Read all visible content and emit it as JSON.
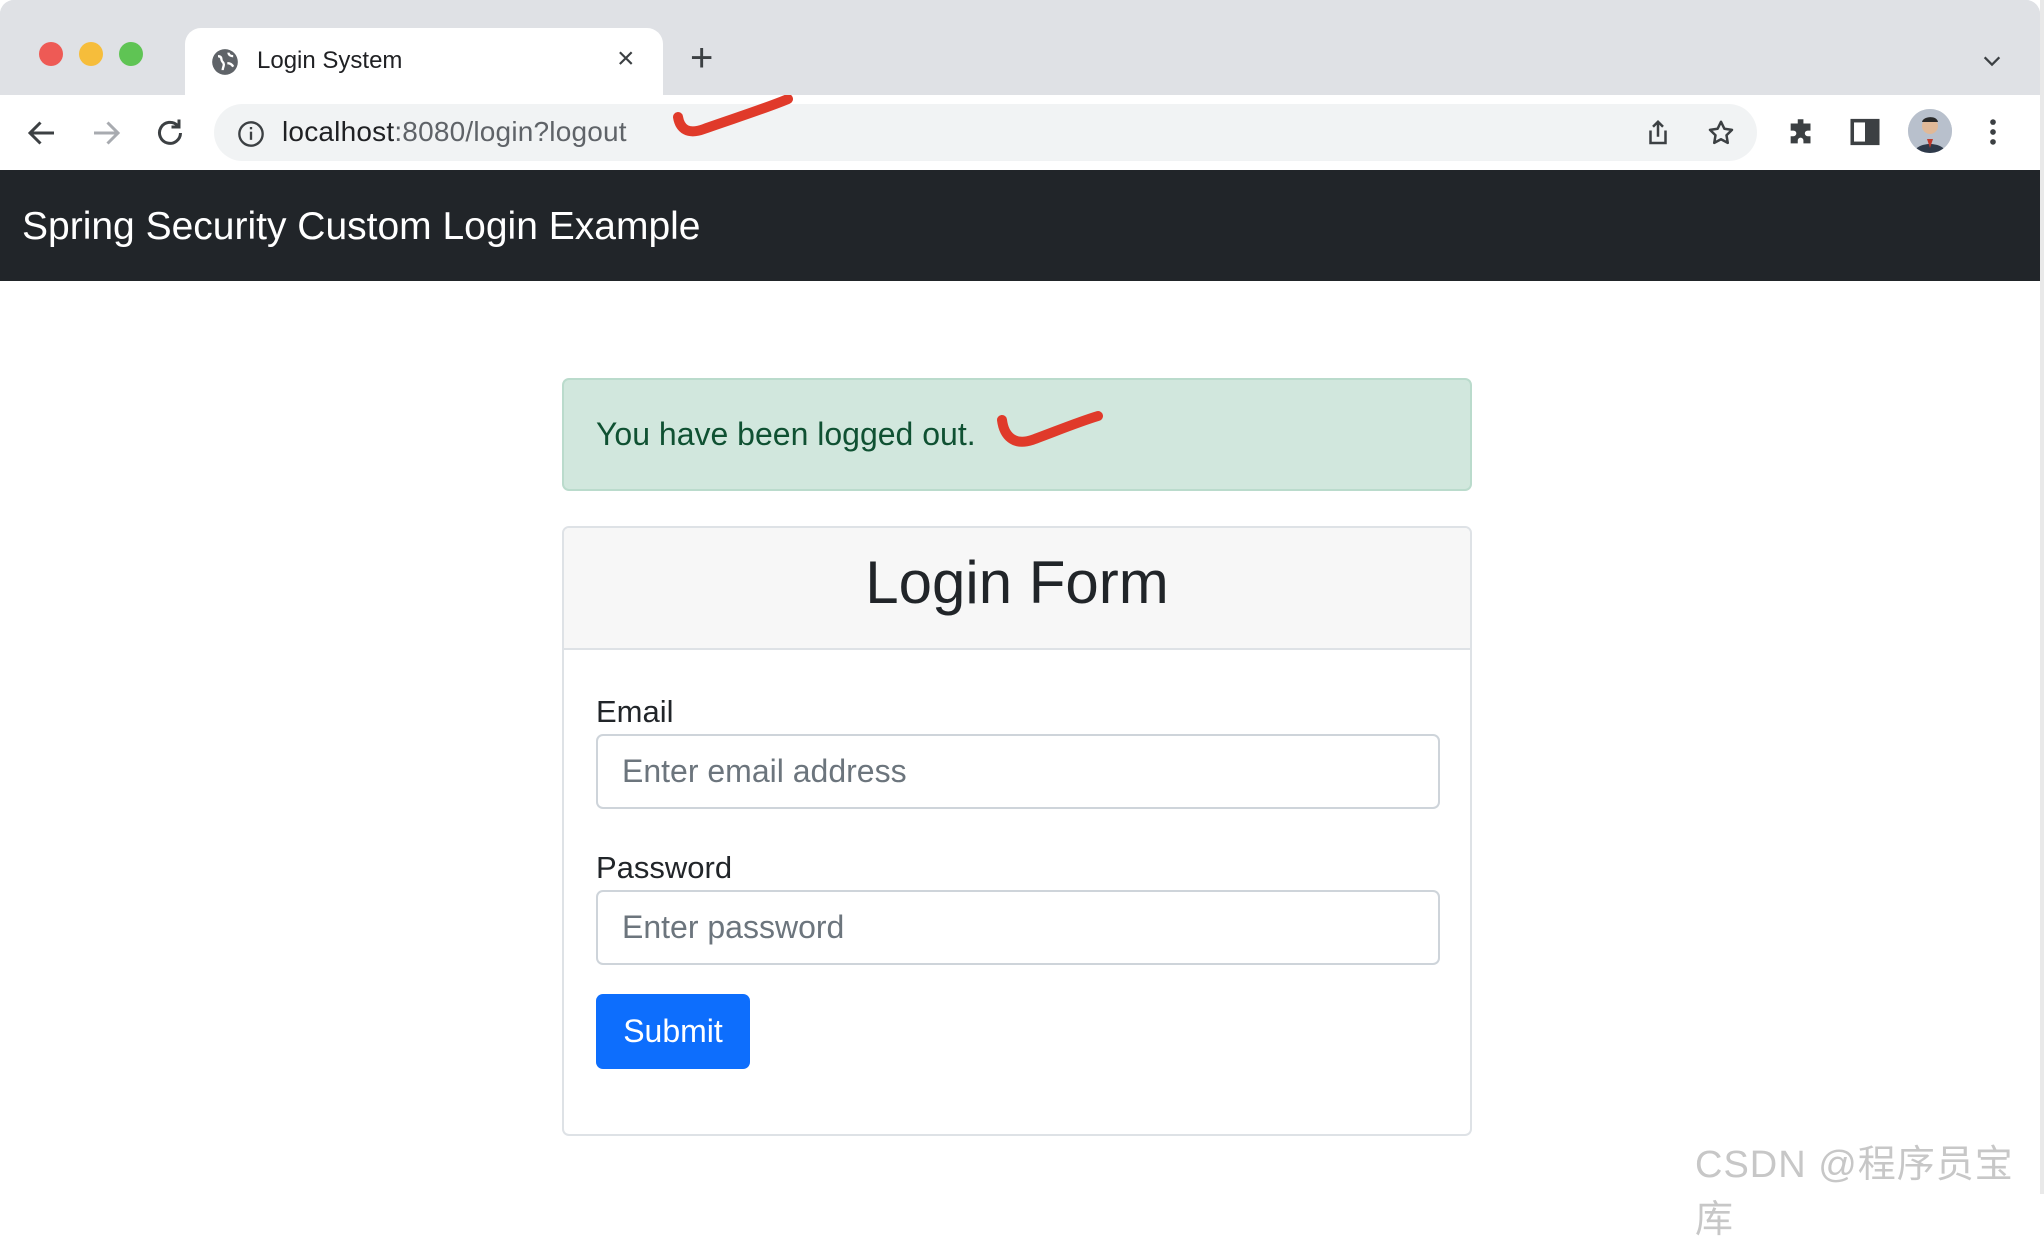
{
  "window": {
    "tab_title": "Login System",
    "new_tab_symbol": "+",
    "close_symbol": "×"
  },
  "toolbar": {
    "url_host": "localhost",
    "url_rest": ":8080/login?logout"
  },
  "icons": [
    "globe-icon",
    "close-icon",
    "plus-icon",
    "chevron-down-icon",
    "back-icon",
    "forward-icon",
    "reload-icon",
    "info-icon",
    "share-icon",
    "star-icon",
    "extensions-icon",
    "side-panel-icon",
    "avatar",
    "more-icon"
  ],
  "navbar": {
    "brand": "Spring Security Custom Login Example"
  },
  "alert": {
    "message": "You have been logged out."
  },
  "form": {
    "title": "Login Form",
    "email_label": "Email",
    "email_placeholder": "Enter email address",
    "email_value": "",
    "password_label": "Password",
    "password_placeholder": "Enter password",
    "password_value": "",
    "submit_label": "Submit"
  },
  "watermark": "CSDN @程序员宝库",
  "colors": {
    "navbar_bg": "#212529",
    "alert_bg": "#d1e7dd",
    "alert_text": "#0f5132",
    "primary": "#0d6efd",
    "annotation": "#e03a2a"
  }
}
